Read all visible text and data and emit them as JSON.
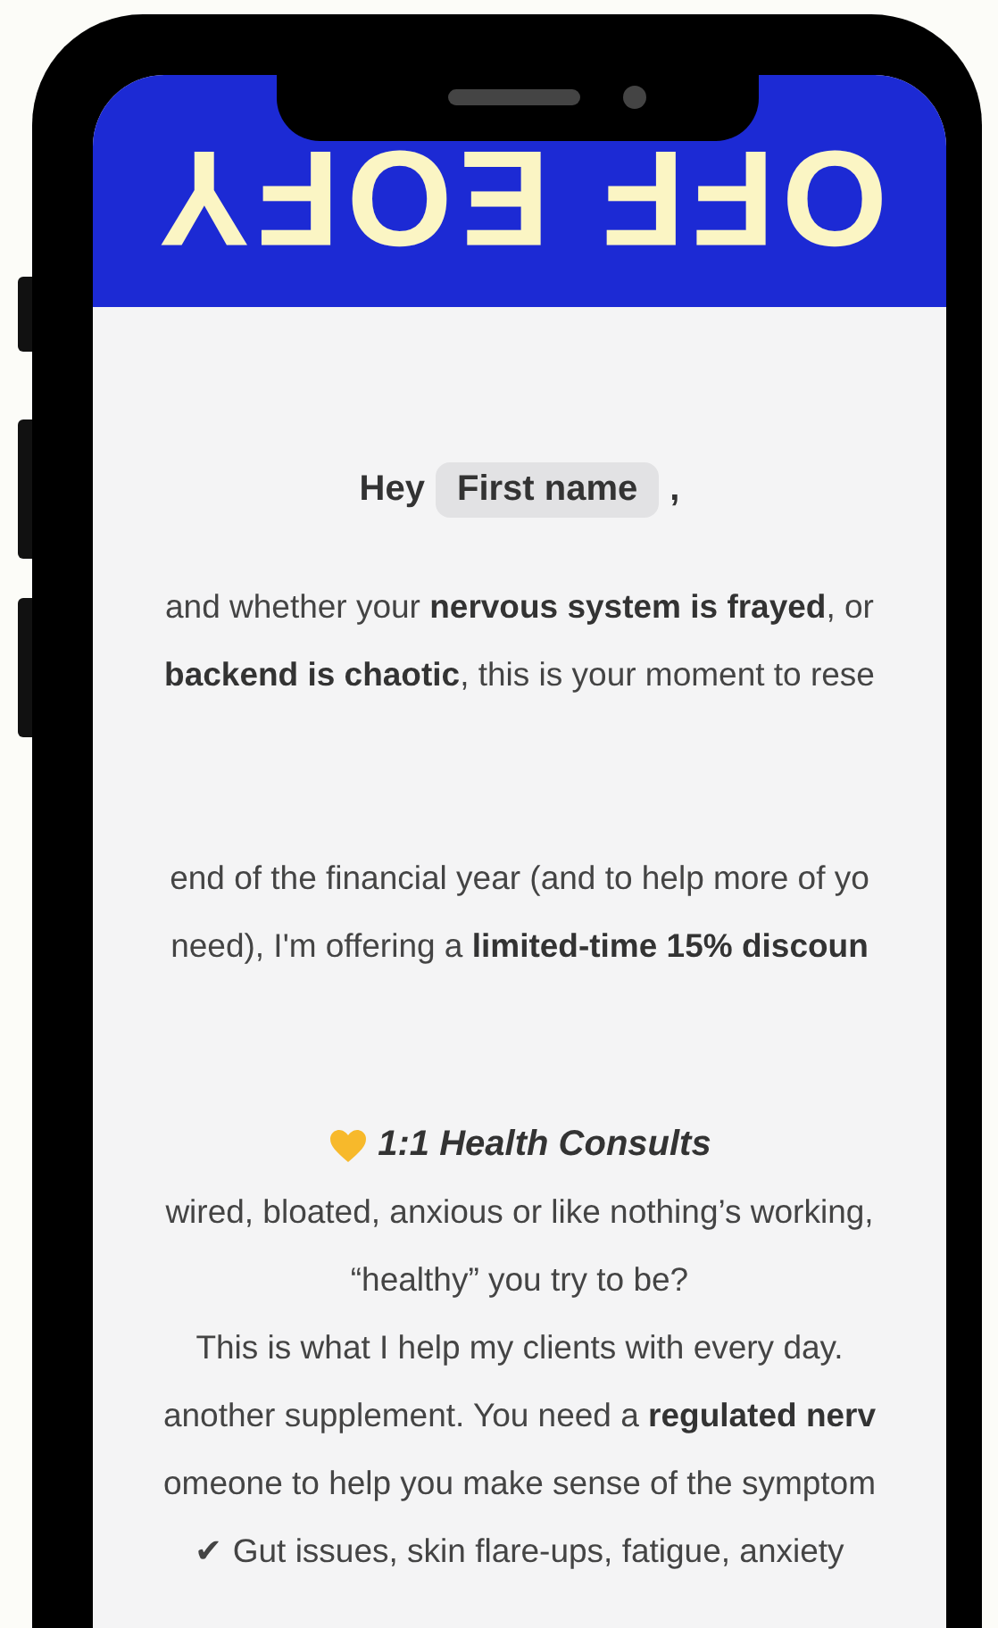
{
  "banner": {
    "text": "OFF EOFY"
  },
  "greeting": {
    "prefix": "Hey",
    "merge_tag": "First name",
    "suffix": ","
  },
  "paragraphs": [
    {
      "lines": [
        "and whether your **nervous system is frayed**, or",
        "**backend is chaotic**, this is your moment to rese"
      ]
    },
    {
      "lines": [
        "end of the financial year (and to help more of yo",
        "need), I'm offering a **limited-time 15% discoun**"
      ]
    }
  ],
  "section": {
    "heading": "1:1 Health Consults",
    "lines": [
      "wired, bloated, anxious or like nothing’s working,",
      "“healthy” you try to be?",
      "This is what I help my clients with every day.",
      "another supplement. You need a **regulated nerv**",
      "omeone to help you make sense of the symptom",
      "✔ Gut issues, skin flare-ups, fatigue, anxiety"
    ]
  }
}
